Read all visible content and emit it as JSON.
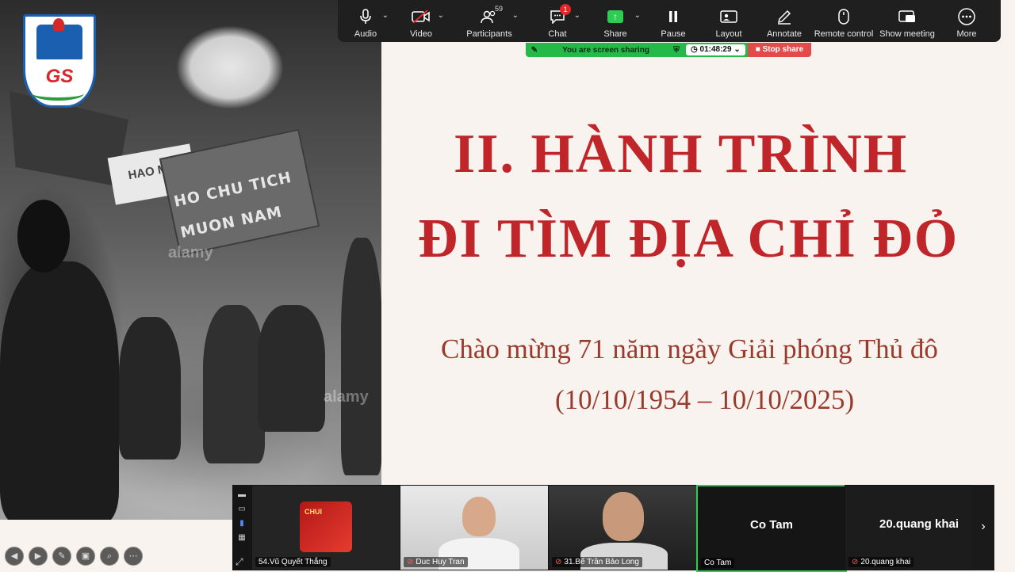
{
  "toolbar": {
    "audio": "Audio",
    "video": "Video",
    "participants": "Participants",
    "participants_count": "59",
    "chat": "Chat",
    "chat_badge": "1",
    "share": "Share",
    "pause": "Pause",
    "layout": "Layout",
    "annotate": "Annotate",
    "remote_control": "Remote control",
    "show_meeting": "Show meeting",
    "more": "More"
  },
  "share_bar": {
    "status": "You are screen sharing",
    "timer": "01:48:29",
    "stop": "Stop share"
  },
  "slide": {
    "title_line1": "II. HÀNH TRÌNH",
    "title_line2": "ĐI TÌM ĐỊA CHỈ ĐỎ",
    "subtitle_line1": "Chào mừng 71 năm ngày Giải phóng Thủ đô",
    "subtitle_line2": "(10/10/1954 – 10/10/2025)",
    "logo_text": "GS",
    "photo_sign_text": "HO CHU TICH MUON NAM",
    "photo_banner_text": "HAO MUN",
    "photo_watermark": "alamy"
  },
  "gallery": {
    "participants": [
      {
        "name": "54.Vũ Quyết Thắng",
        "thumb_text": "CHUI"
      },
      {
        "name": "Duc Huy Tran"
      },
      {
        "name": "31.Bế Trần Bảo Long"
      },
      {
        "name": "Co Tam",
        "display": "Co Tam"
      },
      {
        "name": "20.quang khai",
        "display": "20.quang khai"
      }
    ]
  },
  "colors": {
    "title_red": "#c0252a",
    "share_green": "#25b94a",
    "stop_red": "#e34b4b",
    "toolbar_bg": "#1f1f1f"
  }
}
